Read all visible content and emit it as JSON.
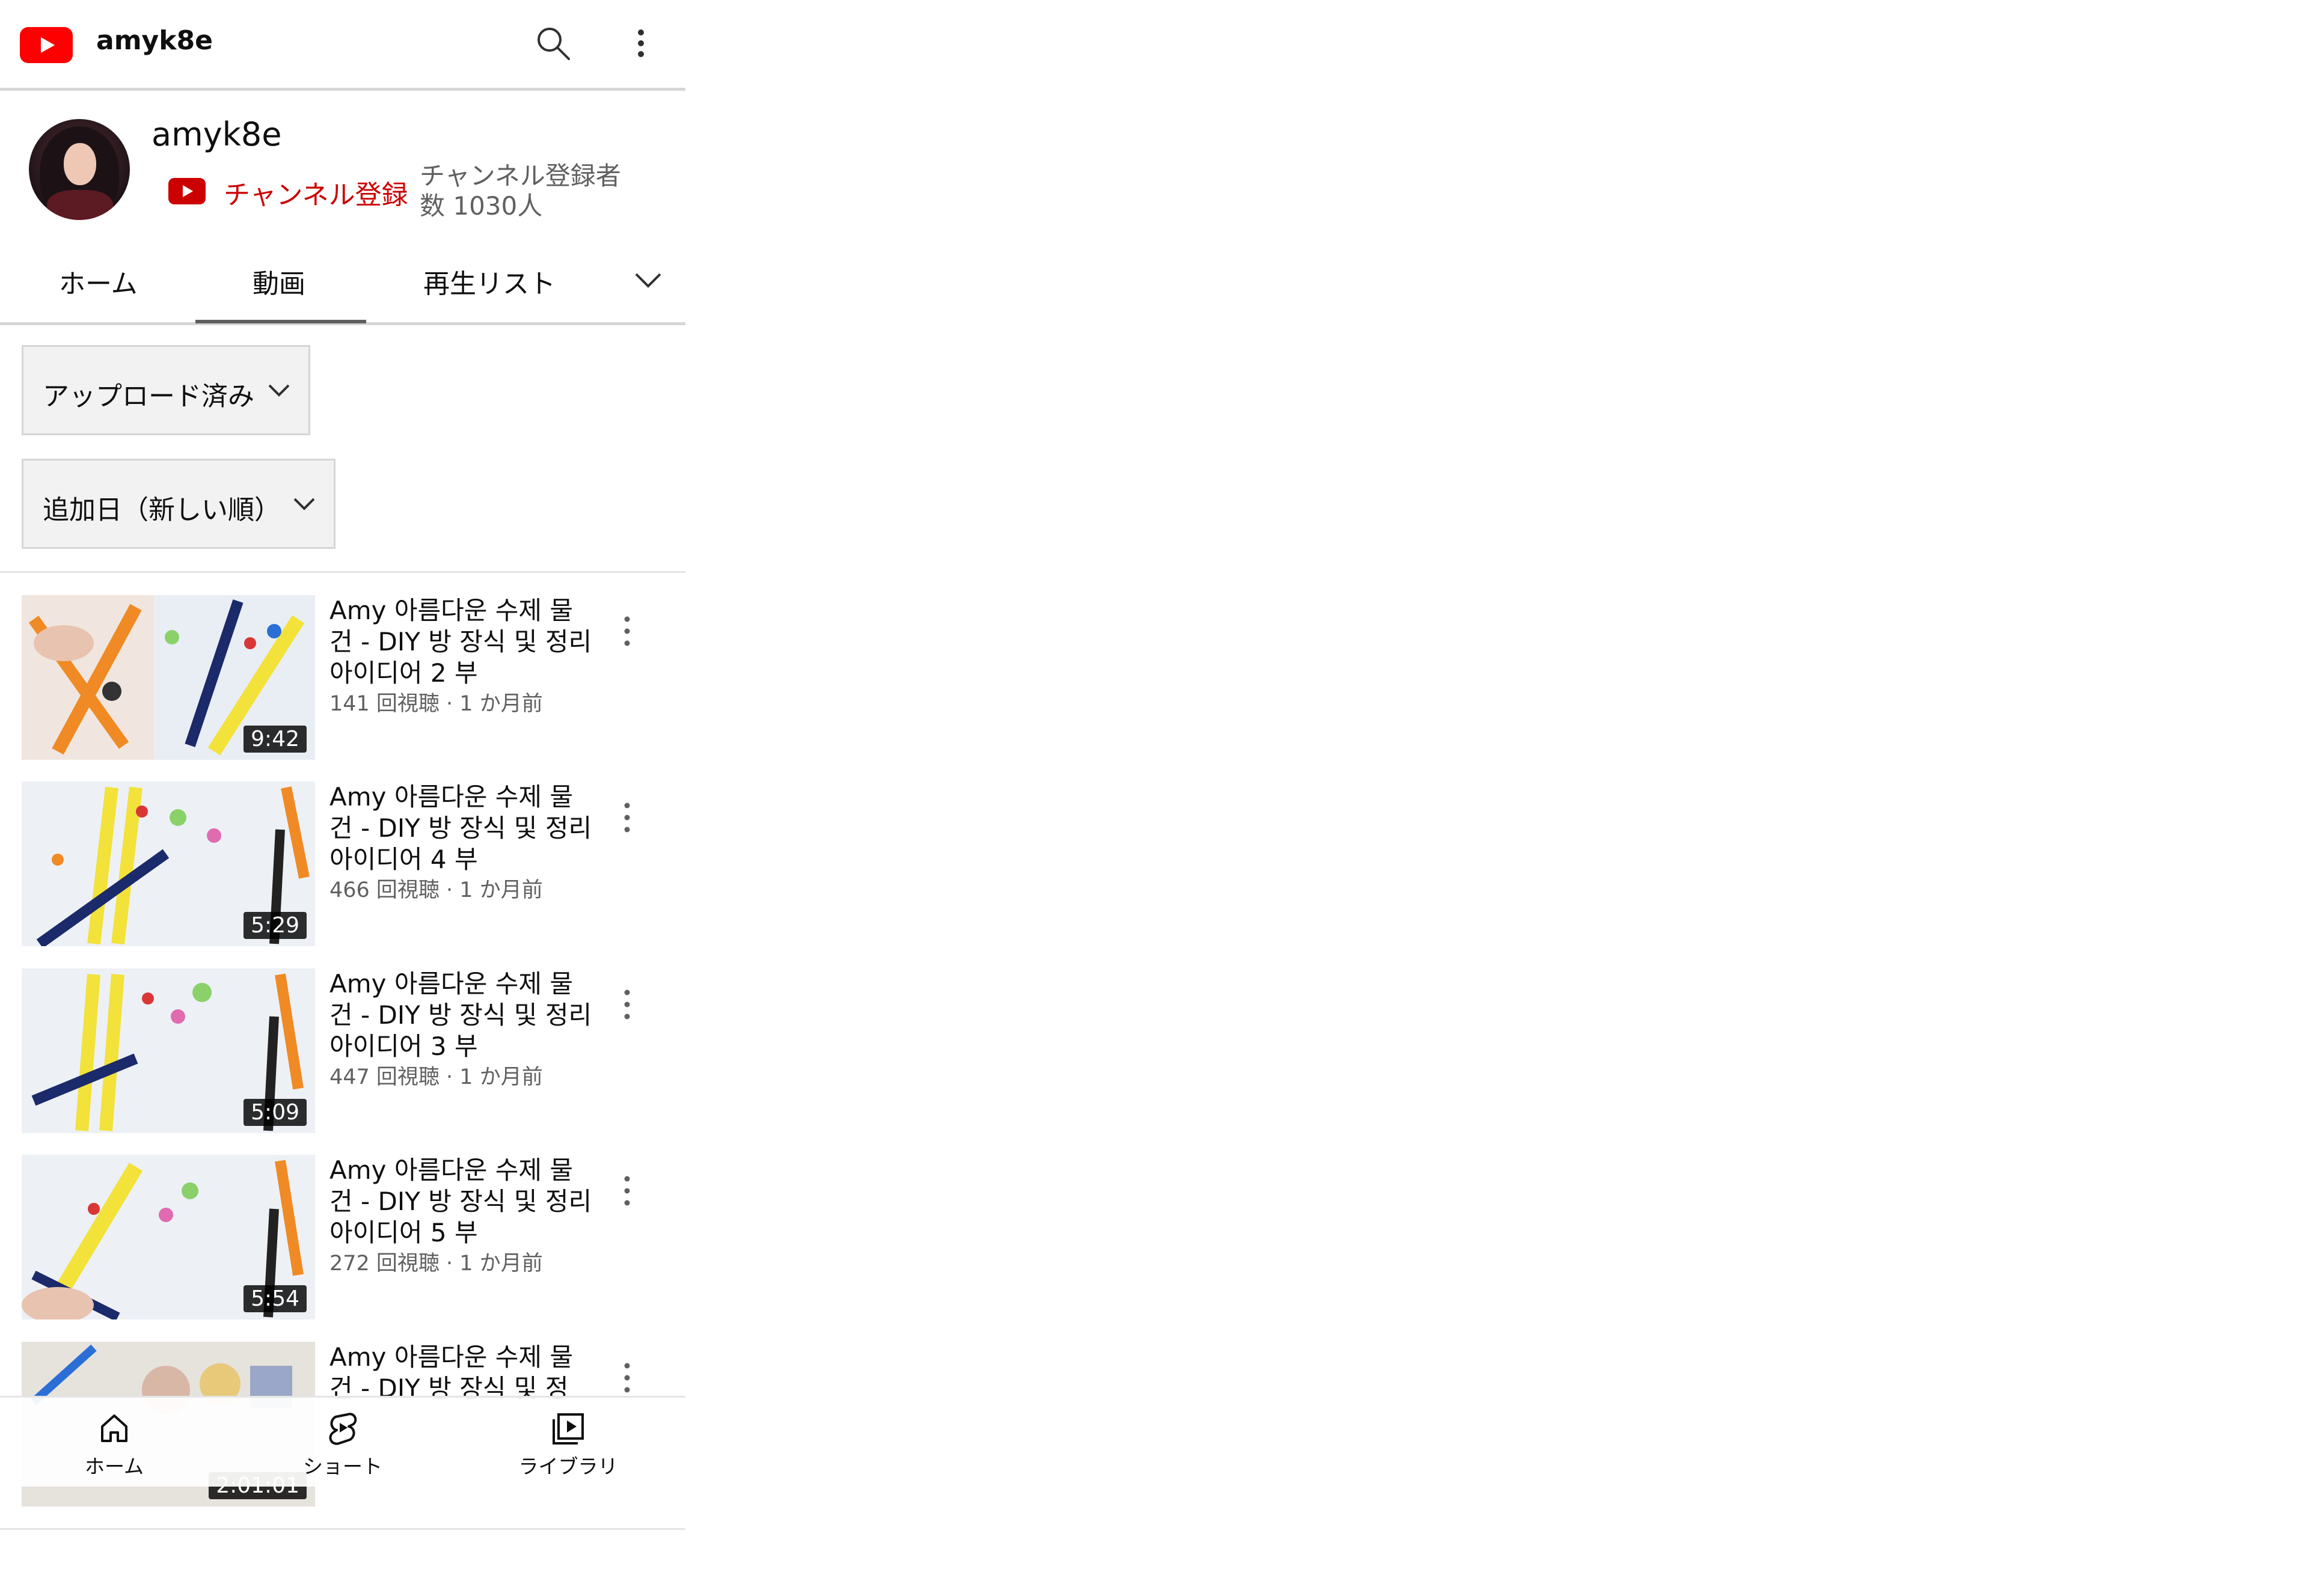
{
  "app": {
    "title": "amyk8e"
  },
  "channel": {
    "name": "amyk8e",
    "subscribe_label": "チャンネル登録",
    "subscriber_text": "チャンネル登録者数 1030人"
  },
  "tabs": [
    {
      "label": "ホーム"
    },
    {
      "label": "動画",
      "selected": true
    },
    {
      "label": "再生リスト"
    }
  ],
  "filters": {
    "uploaded": "アップロード済み",
    "sort": "追加日（新しい順）"
  },
  "videos": [
    {
      "title": "Amy 아름다운 수제 물건 - DIY 방 장식 및 정리 아이디어 2 부",
      "meta": "141 回視聴 · 1 か月前",
      "duration": "9:42"
    },
    {
      "title": "Amy 아름다운 수제 물건 - DIY 방 장식 및 정리 아이디어 4 부",
      "meta": "466 回視聴 · 1 か月前",
      "duration": "5:29"
    },
    {
      "title": "Amy 아름다운 수제 물건 - DIY 방 장식 및 정리 아이디어 3 부",
      "meta": "447 回視聴 · 1 か月前",
      "duration": "5:09"
    },
    {
      "title": "Amy 아름다운 수제 물건 - DIY 방 장식 및 정리 아이디어 5 부",
      "meta": "272 回視聴 · 1 か月前",
      "duration": "5:54"
    },
    {
      "title": "Amy 아름다운 수제 물건 - DIY 방 장식 및 정",
      "meta": "",
      "duration": "2:01:01"
    }
  ],
  "bottom_nav": [
    {
      "label": "ホーム",
      "icon": "home-icon"
    },
    {
      "label": "ショート",
      "icon": "shorts-icon"
    },
    {
      "label": "ライブラリ",
      "icon": "library-icon"
    }
  ],
  "colors": {
    "brand_red": "#ff0000",
    "subscribe_text": "#cc0000",
    "meta_gray": "#606060"
  }
}
